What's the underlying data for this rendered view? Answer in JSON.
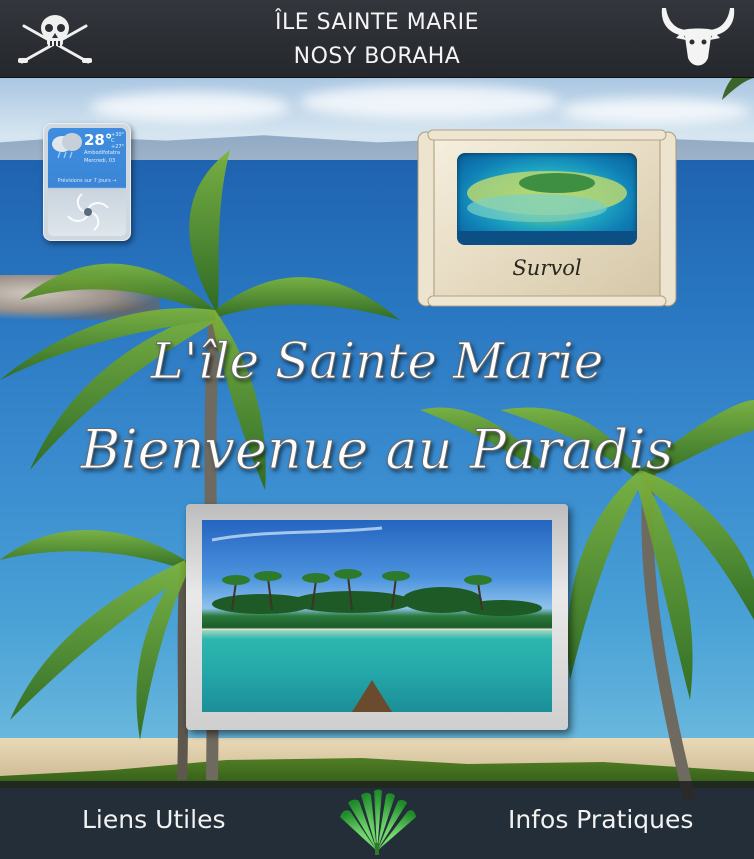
{
  "header": {
    "title_line1": "ÎLE SAINTE MARIE",
    "title_line2": "NOSY BORAHA",
    "left_icon": "pirate-skull-crossed-swords-icon",
    "right_icon": "zebu-horns-icon"
  },
  "weather": {
    "temperature": "28°",
    "minmax_line1": "+30°",
    "minmax_line2": "+27°",
    "unit": "C",
    "city": "Ambodifotatra",
    "date": "Mercredi, 03",
    "forecast_link": "Prévisions sur 7 jours →",
    "condition_icon": "cloud-rain-icon",
    "extra_icon": "cyclone-icon"
  },
  "survol": {
    "label": "Survol"
  },
  "hero": {
    "line1": "L'île Sainte Marie",
    "line2": "Bienvenue au Paradis"
  },
  "footer": {
    "left_link": "Liens Utiles",
    "right_link": "Infos Pratiques",
    "center_icon": "traveller-palm-icon"
  },
  "colors": {
    "header_bg": "#2b2e33",
    "footer_bg": "#1e2022",
    "text_light": "#f2f2f2",
    "sea": "#2a78c2"
  }
}
